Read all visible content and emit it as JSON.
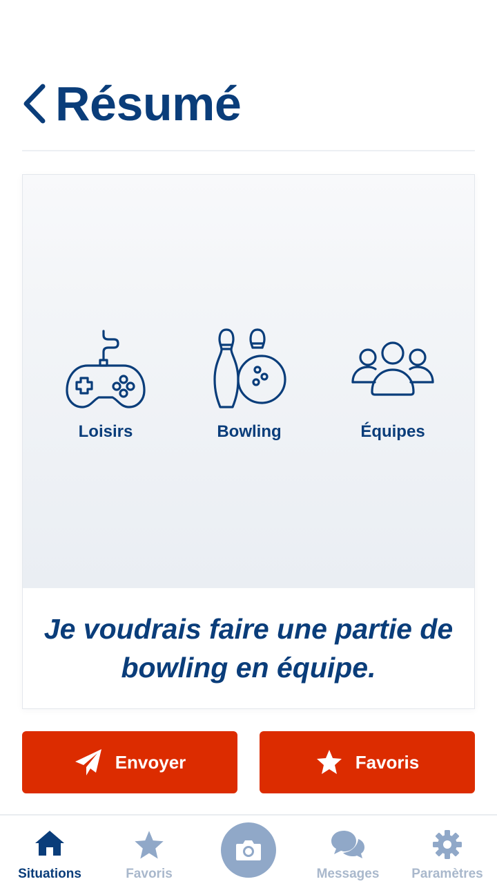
{
  "header": {
    "title": "Résumé",
    "back_icon": "chevron-left-icon"
  },
  "card": {
    "categories": [
      {
        "label": "Loisirs",
        "icon": "gamepad-icon"
      },
      {
        "label": "Bowling",
        "icon": "bowling-icon"
      },
      {
        "label": "Équipes",
        "icon": "team-icon"
      }
    ],
    "sentence": "Je voudrais faire une partie de bowling en équipe."
  },
  "actions": {
    "send": {
      "label": "Envoyer",
      "icon": "paper-plane-icon"
    },
    "favorite": {
      "label": "Favoris",
      "icon": "star-icon"
    }
  },
  "tabbar": {
    "items": [
      {
        "label": "Situations",
        "icon": "home-icon",
        "active": true
      },
      {
        "label": "Favoris",
        "icon": "star-icon",
        "active": false
      },
      {
        "label": "",
        "icon": "camera-icon",
        "active": false
      },
      {
        "label": "Messages",
        "icon": "chat-bubbles-icon",
        "active": false
      },
      {
        "label": "Paramètres",
        "icon": "gear-icon",
        "active": false
      }
    ]
  },
  "colors": {
    "primary": "#0a3d7a",
    "accent": "#dc2c00",
    "inactive": "#a9b8cc",
    "camera": "#90a8c8"
  }
}
